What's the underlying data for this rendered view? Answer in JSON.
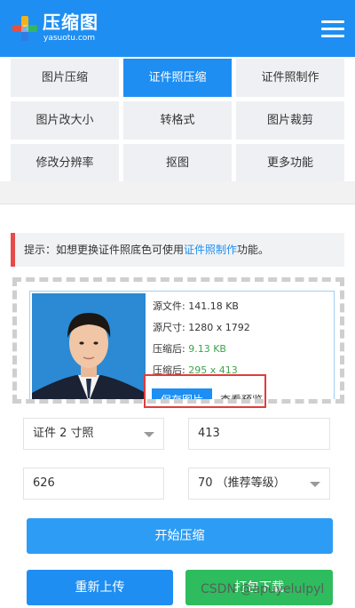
{
  "header": {
    "title": "压缩图",
    "subtitle": "yasuotu.com",
    "logo_icon": "plus-cross-logo-icon",
    "menu_icon": "hamburger-menu-icon"
  },
  "nav": {
    "items": [
      {
        "label": "图片压缩"
      },
      {
        "label": "证件照压缩"
      },
      {
        "label": "证件照制作"
      },
      {
        "label": "图片改大小"
      },
      {
        "label": "转格式"
      },
      {
        "label": "图片裁剪"
      },
      {
        "label": "修改分辨率"
      },
      {
        "label": "抠图"
      },
      {
        "label": "更多功能"
      }
    ],
    "active_index": 1
  },
  "tip": {
    "prefix": "提示：如想更换证件照底色可使用",
    "link": "证件照制作",
    "suffix": "功能。"
  },
  "result": {
    "lines": [
      {
        "label": "源文件:",
        "value": "141.18 KB"
      },
      {
        "label": "源尺寸:",
        "value": "1280 x 1792"
      },
      {
        "label": "压缩后:",
        "value": "9.13 KB"
      },
      {
        "label": "压缩后:",
        "value": "295 x 413"
      }
    ],
    "save_label": "保存图片",
    "preview_label": "查看预览"
  },
  "form": {
    "size_select": "证件 2 寸照",
    "height_value": "413",
    "width_value": "626",
    "quality_select": "70 （推荐等级）"
  },
  "actions": {
    "start_label": "开始压缩",
    "reupload_label": "重新上传",
    "green_label": "打包下载"
  },
  "watermark": "CSDN @apuyelulpyl",
  "colors": {
    "brand": "#1e8ef2",
    "success": "#3aa64a",
    "alert": "#e64a4a"
  }
}
